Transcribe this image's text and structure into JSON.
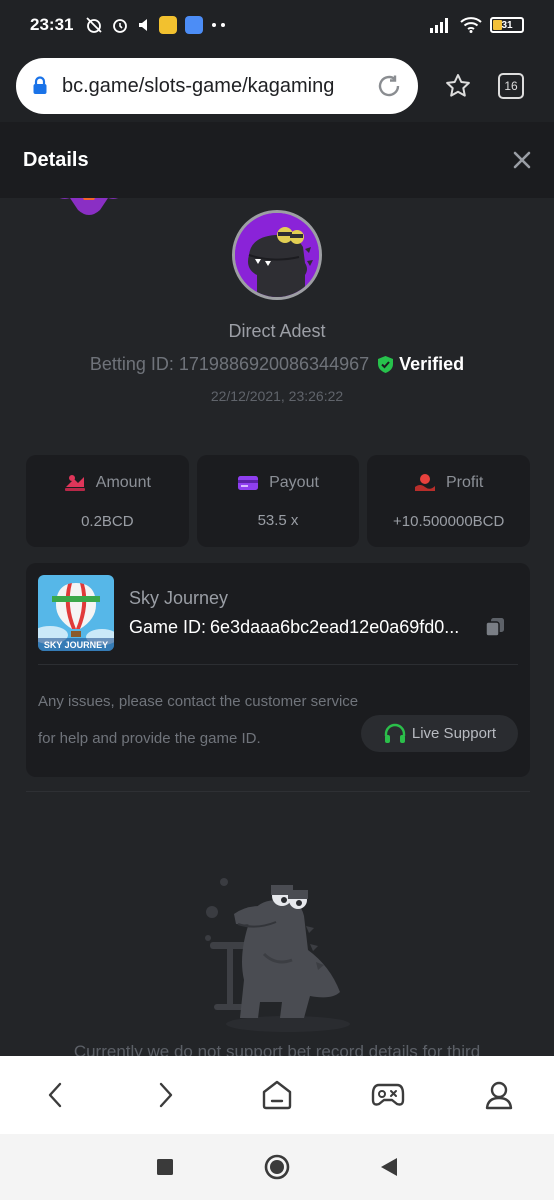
{
  "status_bar": {
    "time": "23:31",
    "battery": "31"
  },
  "browser": {
    "url": "bc.game/slots-game/kagaming",
    "tab_count": "16"
  },
  "modal": {
    "title": "Details",
    "player_name": "Direct Adest",
    "betting_id": "Betting ID: 1719886920086344967",
    "verified_label": "Verified",
    "date": "22/12/2021, 23:26:22",
    "stats": [
      {
        "label": "Amount",
        "value": "0.2BCD"
      },
      {
        "label": "Payout",
        "value": "53.5 x"
      },
      {
        "label": "Profit",
        "value": "+10.500000BCD"
      }
    ],
    "game": {
      "name": "Sky Journey",
      "id_label": "Game ID:",
      "id_value": "6e3daaa6bc2ead12e0a69fd0...",
      "thumb_text": "SKY JOURNEY",
      "issue_text": "Any issues, please contact the customer service for help and provide the game ID.",
      "live_support_label": "Live Support"
    },
    "no_support_text": "Currently we do not support bet record details for third"
  },
  "colors": {
    "verified_green": "#27c24c",
    "amount_icon": "#e0365a",
    "payout_icon": "#8f3ff0",
    "profit_icon": "#e8413d",
    "support_green": "#2bbf4a"
  }
}
